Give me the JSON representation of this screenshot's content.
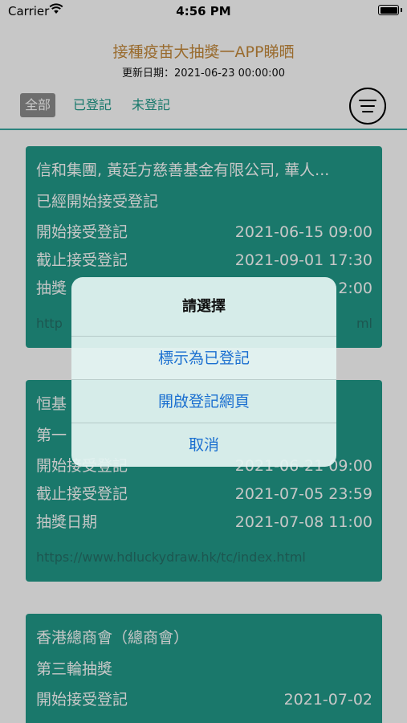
{
  "status": {
    "carrier": "Carrier",
    "time": "4:56 PM"
  },
  "header": {
    "title": "接種疫苗大抽獎一APP睇晒",
    "updated": "更新日期：2021-06-23 00:00:00"
  },
  "tabs": [
    "全部",
    "已登記",
    "未登記"
  ],
  "icons": {
    "wifi": "wifi-icon",
    "battery": "battery-icon",
    "menu": "menu-icon"
  },
  "colors": {
    "accent": "#229a8a",
    "title": "#c58a3c",
    "tab_text": "#1e9a8a",
    "dialog_button": "#1a6fd0"
  },
  "cards": [
    {
      "title": "信和集團, 黃廷方慈善基金有限公司, 華人...",
      "status": "已經開始接受登記",
      "start_label": "開始接受登記",
      "start_value": "2021-06-15 09:00",
      "end_label": "截止接受登記",
      "end_value": "2021-09-01 17:30",
      "draw_label": "抽獎",
      "draw_value": "2:00",
      "link_start": "http",
      "link_end": "ml"
    },
    {
      "title": "恒基",
      "status": "第一",
      "start_label": "開始接受登記",
      "start_value": "2021-06-21 09:00",
      "end_label": "截止接受登記",
      "end_value": "2021-07-05 23:59",
      "draw_label": "抽獎日期",
      "draw_value": "2021-07-08 11:00",
      "link": "https://www.hdluckydraw.hk/tc/index.html"
    },
    {
      "title": "香港總商會（總商會）",
      "status": "第三輪抽獎",
      "start_label": "開始接受登記",
      "start_value": "2021-07-02"
    }
  ],
  "dialog": {
    "title": "請選擇",
    "option_mark": "標示為已登記",
    "option_open": "開啟登記網頁",
    "option_cancel": "取消"
  }
}
